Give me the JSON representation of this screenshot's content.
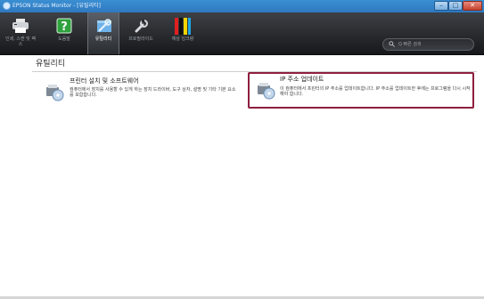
{
  "window": {
    "title": "EPSON Status Monitor - [유틸리티]"
  },
  "toolbar": {
    "items": [
      {
        "label": "인쇄, 스캔 및 팩스",
        "icon": "printer-icon",
        "active": false
      },
      {
        "label": "도움말",
        "icon": "help-icon",
        "active": false
      },
      {
        "label": "유틸리티",
        "icon": "utility-icon",
        "active": true
      },
      {
        "label": "프로필라이드",
        "icon": "wrench-icon",
        "active": false
      },
      {
        "label": "예상 잉크량",
        "icon": "ink-levels-icon",
        "active": false
      }
    ],
    "search_placeholder": "Q 빠른 검색"
  },
  "content": {
    "heading": "유틸리티",
    "cards": [
      {
        "title": "프린터 설치 및 소프트웨어",
        "description": "컴퓨터에서 장치를 사용할 수 있게 하는 장치 드라이버, 도구 상자, 설명 및 기타 기본 요소를 포함합니다.",
        "icon": "setup-disc-icon",
        "highlighted": false
      },
      {
        "title": "IP 주소 업데이트",
        "description": "이 컴퓨터에서 프린터의 IP 주소를 업데이트합니다. IP 주소를 업데이트한 후에는 프로그램을 다시 시작해야 합니다.",
        "icon": "ip-update-icon",
        "highlighted": true
      }
    ]
  },
  "colors": {
    "highlight_border": "#8e1f3f",
    "toolbar_bg": "#2a2c30",
    "titlebar_bg": "#3a8fd2"
  }
}
